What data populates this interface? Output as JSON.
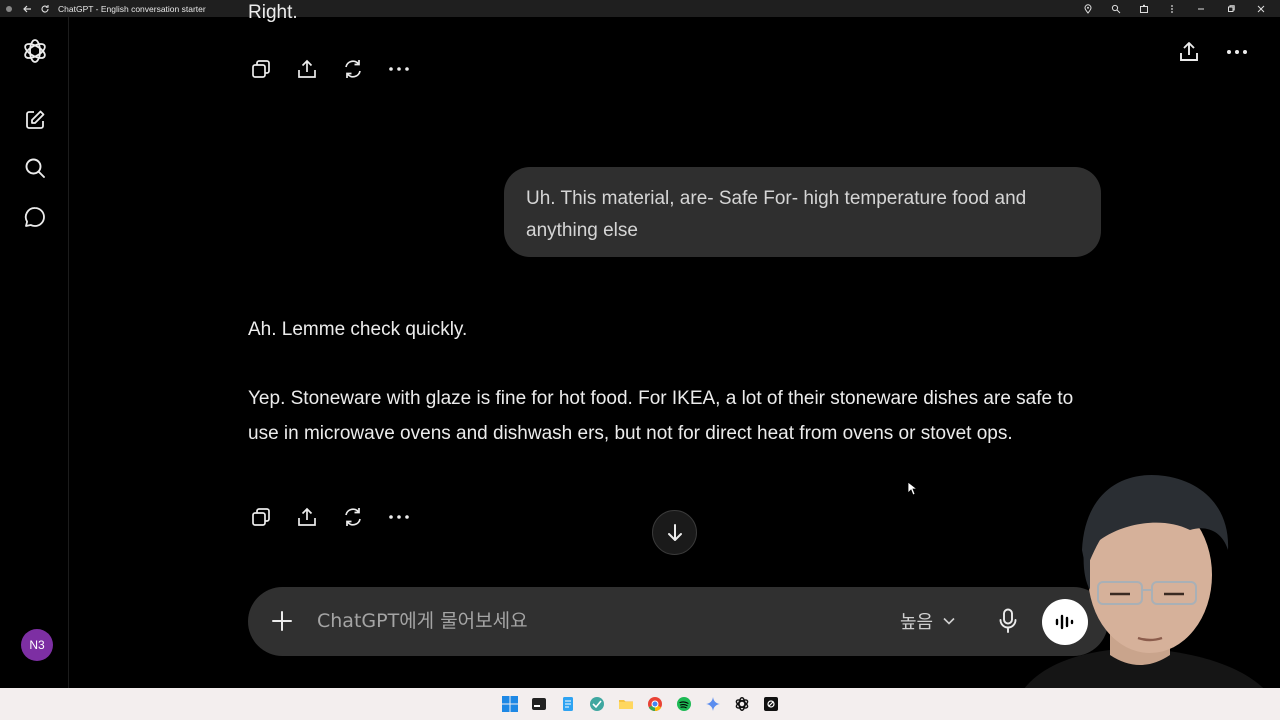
{
  "window": {
    "title": "ChatGPT - English conversation starter"
  },
  "sidebar": {
    "items": [
      {
        "icon": "openai-logo-icon"
      },
      {
        "icon": "new-chat-icon"
      },
      {
        "icon": "search-icon"
      },
      {
        "icon": "chat-bubble-icon"
      }
    ],
    "avatar_initials": "N3",
    "avatar_color": "#7d2fa3"
  },
  "conversation": {
    "partial_text": "Right.",
    "user_message": "Uh. This material, are- Safe For- high temperature food and anything else",
    "assistant_paragraph_1": "Ah. Lemme check quickly.",
    "assistant_paragraph_2": "Yep. Stoneware with glaze is fine for hot food. For IKEA, a lot of their stoneware dishes are safe to use in microwave ovens and dishwash ers, but not for direct heat from ovens or stovet ops."
  },
  "composer": {
    "placeholder": "ChatGPT에게 물어보세요",
    "model_label": "높음"
  },
  "colors": {
    "background": "#000000",
    "bubble": "#2f2f2f",
    "composer": "#303030",
    "taskbar": "#f3eeee"
  }
}
